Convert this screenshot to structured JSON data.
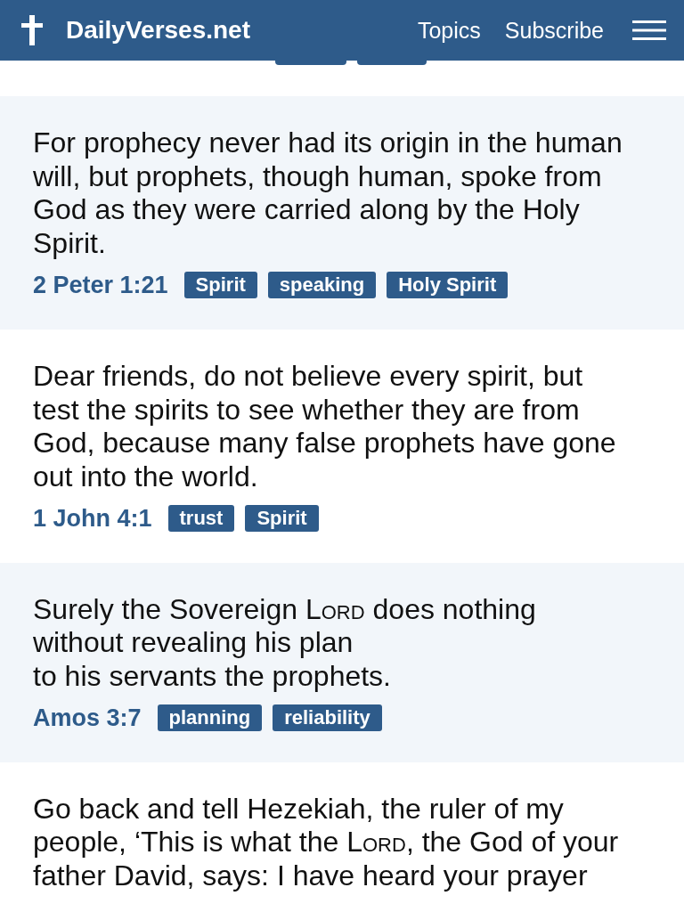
{
  "header": {
    "site_name": "DailyVerses.net",
    "nav": [
      "Topics",
      "Subscribe"
    ]
  },
  "verses": [
    {
      "text": [
        {
          "t": "For prophecy never had its origin in the human\nwill, but prophets, though human, spoke from\nGod as they were carried along by the Holy\nSpirit."
        }
      ],
      "reference": "2 Peter 1:21",
      "tags": [
        "Spirit",
        "speaking",
        "Holy Spirit"
      ]
    },
    {
      "text": [
        {
          "t": "Dear friends, do not believe every spirit, but\ntest the spirits to see whether they are from\nGod, because many false prophets have gone\nout into the world."
        }
      ],
      "reference": "1 John 4:1",
      "tags": [
        "trust",
        "Spirit"
      ]
    },
    {
      "text": [
        {
          "t": "Surely the Sovereign "
        },
        {
          "t": "Lord",
          "small_caps": true
        },
        {
          "t": " does nothing\nwithout revealing his plan\nto his servants the prophets."
        }
      ],
      "reference": "Amos 3:7",
      "tags": [
        "planning",
        "reliability"
      ]
    },
    {
      "text": [
        {
          "t": "Go back and tell Hezekiah, the ruler of my\npeople, ‘This is what the "
        },
        {
          "t": "Lord",
          "small_caps": true
        },
        {
          "t": ", the God of your\nfather David, says: I have heard your prayer"
        }
      ]
    }
  ]
}
